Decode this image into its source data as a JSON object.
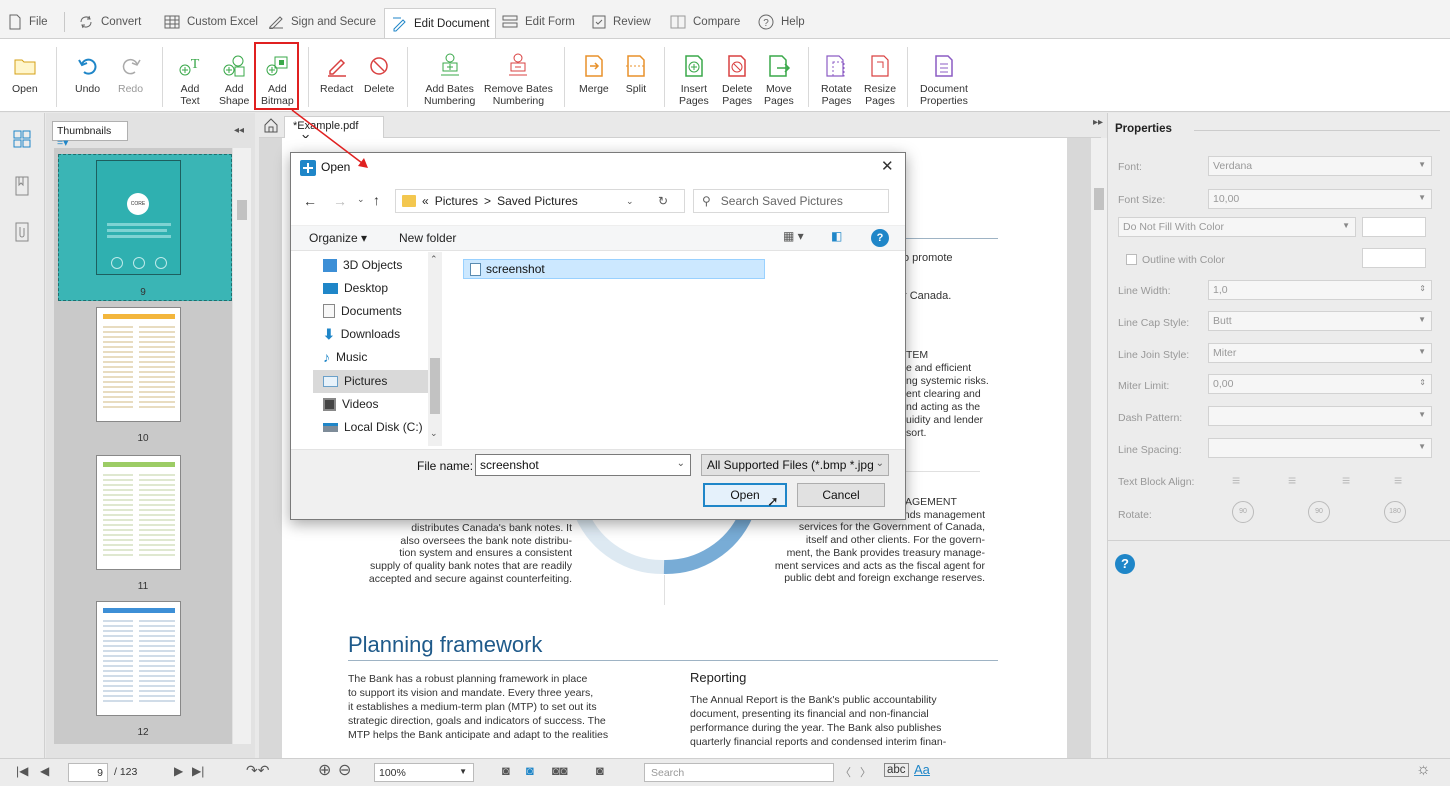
{
  "menu": {
    "items": [
      "File",
      "Convert",
      "Custom Excel",
      "Sign and Secure",
      "Edit Document",
      "Edit Form",
      "Review",
      "Compare",
      "Help"
    ],
    "active": "Edit Document"
  },
  "ribbon": {
    "open": "Open",
    "undo": "Undo",
    "redo": "Redo",
    "add_text": [
      "Add",
      "Text"
    ],
    "add_shape": [
      "Add",
      "Shape"
    ],
    "add_bitmap": [
      "Add",
      "Bitmap"
    ],
    "redact": "Redact",
    "delete": "Delete",
    "add_bates": [
      "Add Bates",
      "Numbering"
    ],
    "remove_bates": [
      "Remove Bates",
      "Numbering"
    ],
    "merge": "Merge",
    "split": "Split",
    "insert_pages": [
      "Insert",
      "Pages"
    ],
    "delete_pages": [
      "Delete",
      "Pages"
    ],
    "move_pages": [
      "Move",
      "Pages"
    ],
    "rotate_pages": [
      "Rotate",
      "Pages"
    ],
    "resize_pages": [
      "Resize",
      "Pages"
    ],
    "doc_props": [
      "Document",
      "Properties"
    ]
  },
  "thumbnails": {
    "selector": "Thumbnails",
    "pages": [
      "9",
      "10",
      "11",
      "12"
    ],
    "collapse": "◂◂"
  },
  "document": {
    "tab": "*Example.pdf",
    "lines_right_top": [
      "o promote",
      "r Canada."
    ],
    "stem_lines": [
      "TEM",
      "e and efficient",
      "ng systemic risks.",
      "ent clearing and",
      "nd acting as the",
      "uidity and lender",
      "sort."
    ],
    "agement_lines": [
      "AGEMENT",
      "unds management",
      "services for the Government of Canada,",
      "itself and other clients. For the govern-",
      "ment, the Bank provides treasury manage-",
      "ment services and acts as the fiscal agent for",
      "public debt and foreign exchange reserves."
    ],
    "left_col": [
      "distributes Canada's bank notes. It",
      "also oversees the bank note distribu-",
      "tion system and ensures a consistent",
      "supply of quality bank notes that are readily",
      "accepted and secure against counterfeiting."
    ],
    "heading": "Planning framework",
    "planning_lines": [
      "The Bank has a robust planning framework in place",
      "to support its vision and mandate. Every three years,",
      "it establishes a medium-term plan (MTP) to set out its",
      "strategic direction, goals and indicators of success. The",
      "MTP helps the Bank anticipate and adapt to the realities"
    ],
    "reporting_title": "Reporting",
    "reporting_lines": [
      "The Annual Report is the Bank's public accountability",
      "document, presenting its financial and non-financial",
      "performance during the year. The Bank also publishes",
      "quarterly financial reports and condensed interim finan-"
    ]
  },
  "properties": {
    "title": "Properties",
    "font_label": "Font:",
    "font_value": "Verdana",
    "font_size_label": "Font Size:",
    "font_size_value": "10,00",
    "fill_value": "Do Not Fill With Color",
    "outline_label": "Outline with Color",
    "line_width_label": "Line Width:",
    "line_width_value": "1,0",
    "line_cap_label": "Line Cap Style:",
    "line_cap_value": "Butt",
    "line_join_label": "Line Join Style:",
    "line_join_value": "Miter",
    "miter_label": "Miter Limit:",
    "miter_value": "0,00",
    "dash_label": "Dash Pattern:",
    "spacing_label": "Line Spacing:",
    "align_label": "Text Block Align:",
    "rotate_label": "Rotate:",
    "rotate_values": [
      "90",
      "90",
      "180"
    ]
  },
  "status": {
    "page": "9",
    "total": "/ 123",
    "zoom": "100%",
    "search_placeholder": "Search",
    "abc": "abc",
    "aa": "Aa"
  },
  "dialog": {
    "title": "Open",
    "path": [
      "«",
      "Pictures",
      ">",
      "Saved Pictures"
    ],
    "search_placeholder": "Search Saved Pictures",
    "organize": "Organize ▾",
    "new_folder": "New folder",
    "nav": [
      "3D Objects",
      "Desktop",
      "Documents",
      "Downloads",
      "Music",
      "Pictures",
      "Videos",
      "Local Disk (C:)"
    ],
    "selected_nav": "Pictures",
    "file": "screenshot",
    "file_name_label": "File name:",
    "file_name_value": "screenshot",
    "filter": "All Supported Files (*.bmp *.jpg",
    "open_btn": "Open",
    "cancel_btn": "Cancel"
  },
  "colors": {
    "accent": "#1f86c8",
    "highlight_box": "#e02020",
    "ribbon_green": "#3aa84a",
    "ribbon_red": "#d94040",
    "ribbon_orange": "#e8912a",
    "ribbon_purple": "#8c5cc4"
  }
}
